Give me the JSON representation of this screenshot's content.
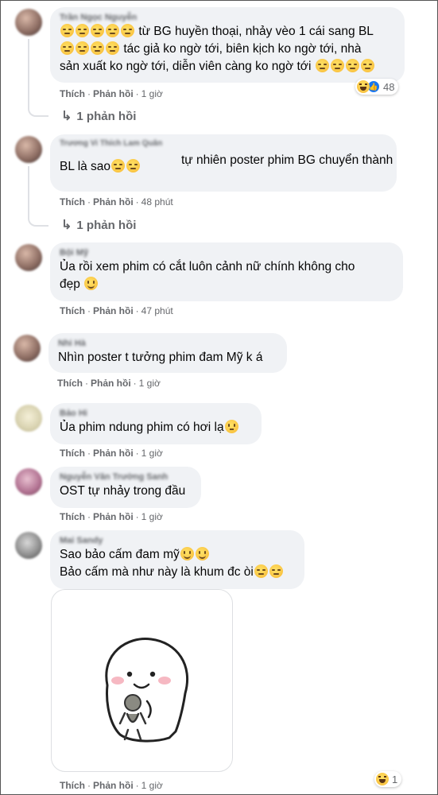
{
  "labels": {
    "like": "Thích",
    "reply": "Phản hồi",
    "dot": "·"
  },
  "comments": [
    {
      "author": "Trần Ngọc Nguyễn",
      "lines": [
        "từ BG huyền thoại, nhảy vèo 1 cái sang BL",
        "tác giả ko ngờ tới, biên kịch ko ngờ tới, nhà",
        "sản xuất ko ngờ tới, diễn viên càng ko ngờ tới"
      ],
      "time": "1 giờ",
      "reaction_count": "48",
      "replies": "1 phản hồi"
    },
    {
      "author": "Trương Vi Thích Lam Quân",
      "lines": [
        "tự nhiên poster phim BG chuyển thành",
        "BL là sao"
      ],
      "time": "48 phút",
      "replies": "1 phản hồi"
    },
    {
      "author": "Bội Mỹ",
      "lines": [
        "Ủa rồi xem phim có cắt luôn cảnh nữ chính không cho",
        "đẹp"
      ],
      "time": "47 phút"
    },
    {
      "author": "Nhi Hà",
      "lines": [
        "Nhìn poster t tưởng phim đam Mỹ k á"
      ],
      "time": "1 giờ"
    },
    {
      "author": "Bảo Hi",
      "lines": [
        "Ủa phim ndung phim có hơi lạ"
      ],
      "time": "1 giờ"
    },
    {
      "author": "Nguyễn Văn Trường Sanh",
      "lines": [
        "OST tự nhảy trong đầu"
      ],
      "time": "1 giờ"
    },
    {
      "author": "Mai Sandy",
      "lines": [
        "Sao bảo cấm đam mỹ",
        "Bảo cấm mà như này là khum đc òi"
      ],
      "time": "1 giờ",
      "reaction_count": "1"
    }
  ],
  "icons": {
    "haha": "haha-reaction-icon",
    "like": "like-reaction-icon",
    "reply_arrow": "reply-arrow-icon"
  }
}
